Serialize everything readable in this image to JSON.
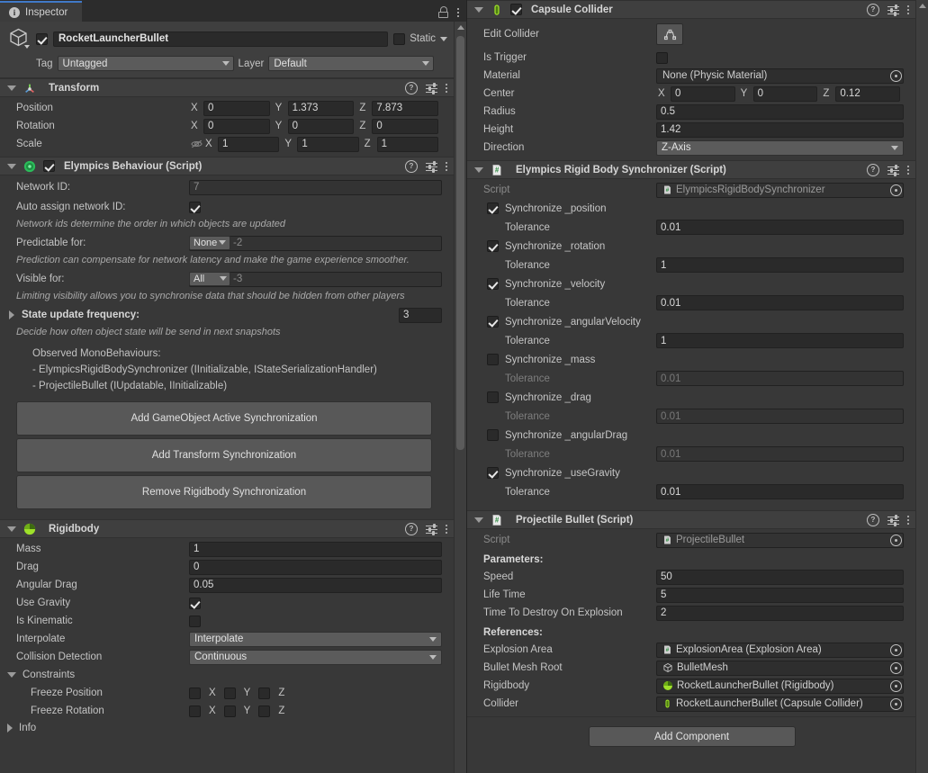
{
  "tab": {
    "label": "Inspector",
    "icon": "info-icon",
    "lock_icon": "lock-icon",
    "menu_icon": "kebab-menu-icon"
  },
  "gameobject": {
    "name": "RocketLauncherBullet",
    "enabled": true,
    "static_label": "Static",
    "tag_label": "Tag",
    "tag_value": "Untagged",
    "layer_label": "Layer",
    "layer_value": "Default"
  },
  "transform": {
    "title": "Transform",
    "rows": [
      {
        "label": "Position",
        "x": "0",
        "y": "1.373",
        "z": "7.873"
      },
      {
        "label": "Rotation",
        "x": "0",
        "y": "0",
        "z": "0"
      },
      {
        "label": "Scale",
        "x": "1",
        "y": "1",
        "z": "1"
      }
    ],
    "axis_x": "X",
    "axis_y": "Y",
    "axis_z": "Z"
  },
  "elympics_behaviour": {
    "title": "Elympics Behaviour (Script)",
    "enabled": true,
    "network_id_label": "Network ID:",
    "network_id_value": "7",
    "auto_assign_label": "Auto assign network ID:",
    "auto_assign_checked": true,
    "auto_assign_note": "Network ids determine the order in which objects are updated",
    "predictable_label": "Predictable for:",
    "predictable_value": "None",
    "predictable_num": "-2",
    "predictable_note": "Prediction can compensate for network latency and make the game experience smoother.",
    "visible_label": "Visible for:",
    "visible_value": "All",
    "visible_num": "-3",
    "visible_note": "Limiting visibility allows you to synchronise data that should be hidden from other players",
    "state_freq_label": "State update frequency:",
    "state_freq_value": "3",
    "state_freq_note": "Decide how often object state will be send in next snapshots",
    "observed_title": "Observed MonoBehaviours:",
    "observed_items": [
      "- ElympicsRigidBodySynchronizer (IInitializable, IStateSerializationHandler)",
      "- ProjectileBullet (IUpdatable, IInitializable)"
    ],
    "buttons": [
      "Add GameObject Active Synchronization",
      "Add Transform Synchronization",
      "Remove Rigidbody Synchronization"
    ]
  },
  "rigidbody": {
    "title": "Rigidbody",
    "mass_label": "Mass",
    "mass_value": "1",
    "drag_label": "Drag",
    "drag_value": "0",
    "angular_drag_label": "Angular Drag",
    "angular_drag_value": "0.05",
    "use_gravity_label": "Use Gravity",
    "use_gravity_checked": true,
    "is_kinematic_label": "Is Kinematic",
    "is_kinematic_checked": false,
    "interpolate_label": "Interpolate",
    "interpolate_value": "Interpolate",
    "collision_label": "Collision Detection",
    "collision_value": "Continuous",
    "constraints_label": "Constraints",
    "freeze_position_label": "Freeze Position",
    "freeze_rotation_label": "Freeze Rotation",
    "axis_x": "X",
    "axis_y": "Y",
    "axis_z": "Z",
    "info_label": "Info"
  },
  "capsule_collider": {
    "title": "Capsule Collider",
    "enabled": true,
    "edit_collider_label": "Edit Collider",
    "is_trigger_label": "Is Trigger",
    "is_trigger_checked": false,
    "material_label": "Material",
    "material_value": "None (Physic Material)",
    "center_label": "Center",
    "center_x": "0",
    "center_y": "0",
    "center_z": "0.12",
    "radius_label": "Radius",
    "radius_value": "0.5",
    "height_label": "Height",
    "height_value": "1.42",
    "direction_label": "Direction",
    "direction_value": "Z-Axis",
    "axis_x": "X",
    "axis_y": "Y",
    "axis_z": "Z"
  },
  "rigidbody_sync": {
    "title": "Elympics Rigid Body Synchronizer (Script)",
    "script_label": "Script",
    "script_value": "ElympicsRigidBodySynchronizer",
    "tolerance_label": "Tolerance",
    "items": [
      {
        "label": "Synchronize _position",
        "checked": true,
        "tolerance": "0.01"
      },
      {
        "label": "Synchronize _rotation",
        "checked": true,
        "tolerance": "1"
      },
      {
        "label": "Synchronize _velocity",
        "checked": true,
        "tolerance": "0.01"
      },
      {
        "label": "Synchronize _angularVelocity",
        "checked": true,
        "tolerance": "1"
      },
      {
        "label": "Synchronize _mass",
        "checked": false,
        "tolerance": "0.01"
      },
      {
        "label": "Synchronize _drag",
        "checked": false,
        "tolerance": "0.01"
      },
      {
        "label": "Synchronize _angularDrag",
        "checked": false,
        "tolerance": "0.01"
      },
      {
        "label": "Synchronize _useGravity",
        "checked": true,
        "tolerance": "0.01"
      }
    ]
  },
  "projectile_bullet": {
    "title": "Projectile Bullet (Script)",
    "script_label": "Script",
    "script_value": "ProjectileBullet",
    "parameters_header": "Parameters:",
    "parameters": [
      {
        "label": "Speed",
        "value": "50"
      },
      {
        "label": "Life Time",
        "value": "5"
      },
      {
        "label": "Time To Destroy On Explosion",
        "value": "2"
      }
    ],
    "references_header": "References:",
    "references": [
      {
        "label": "Explosion Area",
        "value": "ExplosionArea (Explosion Area)",
        "icon": "script-icon"
      },
      {
        "label": "Bullet Mesh Root",
        "value": "BulletMesh",
        "icon": "gameobject-icon"
      },
      {
        "label": "Rigidbody",
        "value": "RocketLauncherBullet (Rigidbody)",
        "icon": "rigidbody-icon"
      },
      {
        "label": "Collider",
        "value": "RocketLauncherBullet (Capsule Collider)",
        "icon": "capsule-collider-icon"
      }
    ]
  },
  "add_component_label": "Add Component",
  "colors": {
    "accent_tab": "#4079c8",
    "panel_bg": "#383838",
    "header_bg": "#3f3f3f",
    "field_bg": "#2a2a2a",
    "button_bg": "#585858",
    "green_icon": "#8cd211",
    "text": "#c4c4c4"
  }
}
